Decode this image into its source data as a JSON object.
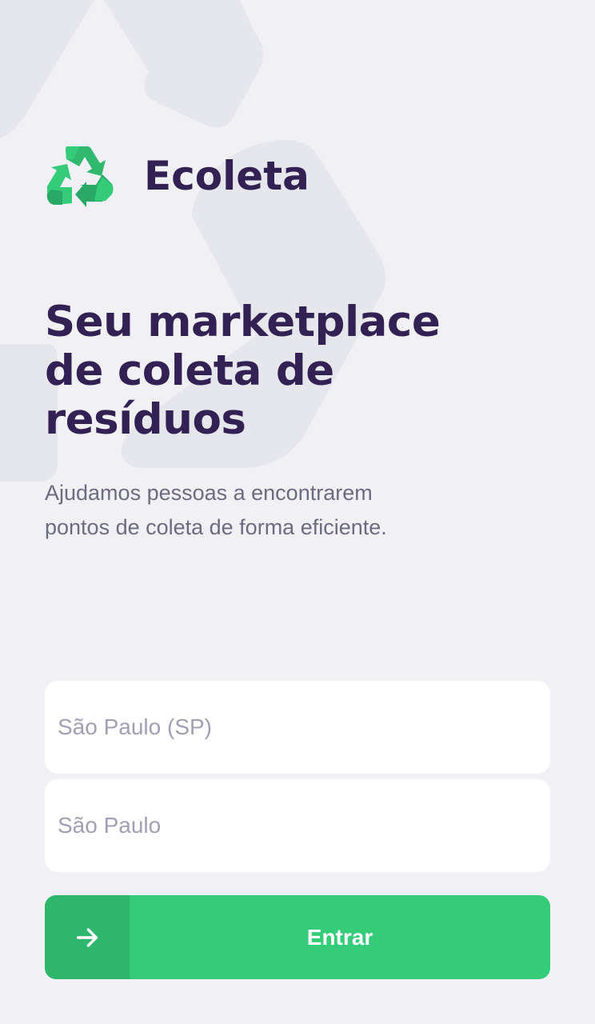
{
  "app": {
    "name": "Ecoleta",
    "logo_icon": "recycle-icon",
    "brand_color": "#34CB79",
    "title_color": "#322153",
    "text_color": "#6C6C80",
    "background_color": "#F0F0F5"
  },
  "main": {
    "title": "Seu marketplace de coleta de resíduos",
    "description": "Ajudamos pessoas a encontrarem pontos de coleta de forma eficiente."
  },
  "form": {
    "uf_placeholder": "São Paulo (SP)",
    "city_placeholder": "São Paulo",
    "submit_label": "Entrar",
    "submit_icon": "arrow-right-icon"
  }
}
